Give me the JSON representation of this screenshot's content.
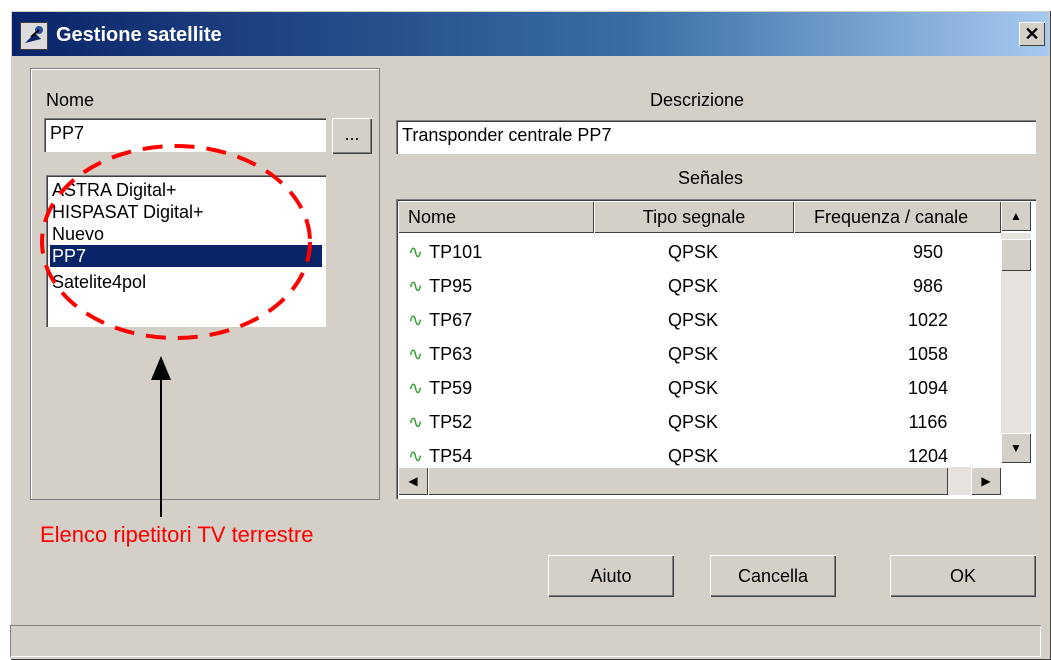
{
  "window": {
    "title": "Gestione satellite",
    "close_glyph": "✕"
  },
  "left": {
    "nome_label": "Nome",
    "nome_value": "PP7",
    "browse_label": "...",
    "list_items": [
      "ASTRA Digital+",
      "HISPASAT Digital+",
      "Nuevo",
      "PP7",
      "Satelite4pol"
    ],
    "selected_index": 3
  },
  "right": {
    "descrizione_label": "Descrizione",
    "descrizione_value": "Transponder centrale PP7",
    "senales_label": "Señales",
    "columns": [
      "Nome",
      "Tipo segnale",
      "Frequenza / canale"
    ],
    "rows": [
      {
        "name": "TP101",
        "type": "QPSK",
        "freq": "950"
      },
      {
        "name": "TP95",
        "type": "QPSK",
        "freq": "986"
      },
      {
        "name": "TP67",
        "type": "QPSK",
        "freq": "1022"
      },
      {
        "name": "TP63",
        "type": "QPSK",
        "freq": "1058"
      },
      {
        "name": "TP59",
        "type": "QPSK",
        "freq": "1094"
      },
      {
        "name": "TP52",
        "type": "QPSK",
        "freq": "1166"
      },
      {
        "name": "TP54",
        "type": "QPSK",
        "freq": "1204"
      }
    ]
  },
  "buttons": {
    "help": "Aiuto",
    "cancel": "Cancella",
    "ok": "OK"
  },
  "annotation": {
    "text": "Elenco ripetitori TV terrestre",
    "color": "#ff0000"
  },
  "icons": {
    "app": "satellite-dish-icon",
    "signal": "sine-wave-icon"
  }
}
